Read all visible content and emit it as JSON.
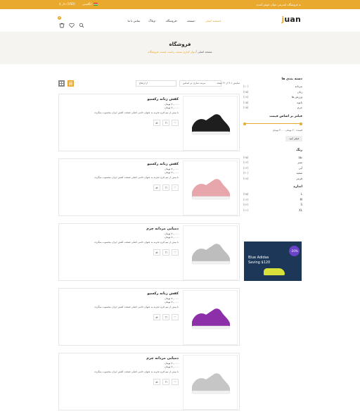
{
  "topbar": {
    "message": "به فروشگاه اینترنتی جوان خوش آمدید",
    "currency": "$ دلار (USD)",
    "language": "انگلیسی"
  },
  "header": {
    "logo_first": "j",
    "logo_rest": "uan",
    "nav": [
      {
        "label": "صفحه اصلی",
        "active": true,
        "caret": true
      },
      {
        "label": "صفحه",
        "active": false,
        "caret": true
      },
      {
        "label": "فروشگاه",
        "active": false,
        "caret": true
      },
      {
        "label": "وبلاگ",
        "active": false,
        "caret": true
      },
      {
        "label": "تماس با ما",
        "active": false,
        "caret": false
      }
    ],
    "cart_count": "0"
  },
  "banner": {
    "title": "فروشگاه",
    "crumb_home": "صفحه اصلی",
    "crumb_sep": "/",
    "crumb_current": "نوار کناری سمت راست لیست فروشگاه"
  },
  "toolbar": {
    "results": "نمایش ۱-۴ از ۲۱ نتیجه",
    "sort_label": "مرتب سازی بر اساس",
    "sort_value": "پیش فرض",
    "per_page": "از ارتفاع"
  },
  "sidebar": {
    "categories_title": "دسته بندی ها",
    "categories": [
      {
        "name": "مردانه",
        "count": "(۱۰)"
      },
      {
        "name": "زنان",
        "count": "(۲۵)"
      },
      {
        "name": "ورزش ها",
        "count": "(۱۸)"
      },
      {
        "name": "بانوه",
        "count": "(۱۵)"
      },
      {
        "name": "چرم",
        "count": "(۱۵)"
      }
    ],
    "price_title": "فیلتر بر اساس قیمت",
    "price_text": "قیمت: ۲۰ تومان - ۳۰۰ تومان",
    "filter_button": "فیلتر کنید",
    "colors_title": "رنگ",
    "colors": [
      {
        "name": "طلا",
        "count": "(۲۵)"
      },
      {
        "name": "سبز",
        "count": "(۱۲)"
      },
      {
        "name": "آبی",
        "count": "(۱۲)"
      },
      {
        "name": "سفید",
        "count": "(۲۰)"
      },
      {
        "name": "قرمز",
        "count": "(۱۸)"
      }
    ],
    "size_title": "اندازه",
    "sizes": [
      {
        "name": "L",
        "count": "(۴۵)"
      },
      {
        "name": "M",
        "count": "(۱۲)"
      },
      {
        "name": "S",
        "count": "(۲۶)"
      },
      {
        "name": "XL",
        "count": "(۱۱)"
      }
    ],
    "promo": {
      "percent": "-20%",
      "line1": "Blue Adidas",
      "line2": "Saving $120"
    }
  },
  "products": [
    {
      "name": "کفش زنانه رکسیو",
      "old_price": "۸۰,۰۰۰ تومان",
      "price": "۸۰,۰۰۰ تومان",
      "desc": "با بیش از نیم قرن تجربه به عنوان حامی اصلی صنعت کفش ایران محسوب میگردد.",
      "shoe_color": "#1e1e1e"
    },
    {
      "name": "کفش زنانه رکسیو",
      "old_price": "۸۰,۰۰۰ تومان",
      "price": "۸۰,۰۰۰ تومان",
      "desc": "با بیش از نیم قرن تجربه به عنوان حامی اصلی صنعت کفش ایران محسوب میگردد.",
      "shoe_color": "#e6a6ab"
    },
    {
      "name": "دمپایی مردانه چرم",
      "old_price": "۸۰,۰۰۰ تومان",
      "price": "۸۰,۰۰۰ تومان",
      "desc": "با بیش از نیم قرن تجربه به عنوان حامی اصلی صنعت کفش ایران محسوب میگردد.",
      "shoe_color": "#bdbdbd"
    },
    {
      "name": "کفش زنانه رکسیو",
      "old_price": "۸۰,۰۰۰ تومان",
      "price": "۸۰,۰۰۰ تومان",
      "desc": "با بیش از نیم قرن تجربه به عنوان حامی اصلی صنعت کفش ایران محسوب میگردد.",
      "shoe_color": "#8c2fa8"
    },
    {
      "name": "دمپایی مردانه چرم",
      "old_price": "۸۰,۰۰۰ تومان",
      "price": "۸۰,۰۰۰ تومان",
      "desc": "با بیش از نیم قرن تجربه به عنوان حامی اصلی صنعت کفش ایران محسوب میگردد.",
      "shoe_color": "#c6c6c6"
    }
  ],
  "colors": {
    "accent": "#e8a92e"
  }
}
